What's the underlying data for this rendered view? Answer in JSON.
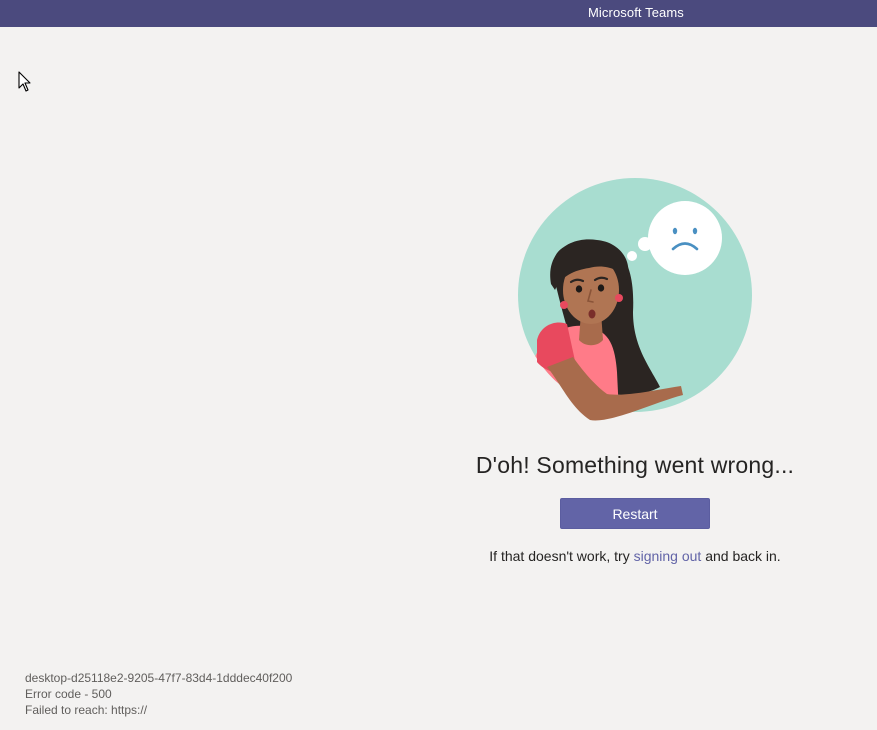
{
  "window": {
    "title": "Microsoft Teams"
  },
  "error": {
    "heading": "D'oh! Something went wrong...",
    "restart_label": "Restart",
    "hint_before": "If that doesn't work, try ",
    "hint_link": "signing out",
    "hint_after": " and back in."
  },
  "diagnostics": {
    "machine_id": "desktop-d25118e2-9205-47f7-83d4-1dddec40f200",
    "error_code": "Error code - 500",
    "failed_to_reach": "Failed to reach: https://"
  },
  "colors": {
    "titlebar": "#4b4a7e",
    "background": "#f3f2f1",
    "accent": "#6264a7",
    "illustration_circle": "#a8ddd0"
  },
  "icons": {
    "cursor": "mouse-pointer-icon",
    "illustration": "sad-person-illustration",
    "thought": "sad-face-icon"
  }
}
